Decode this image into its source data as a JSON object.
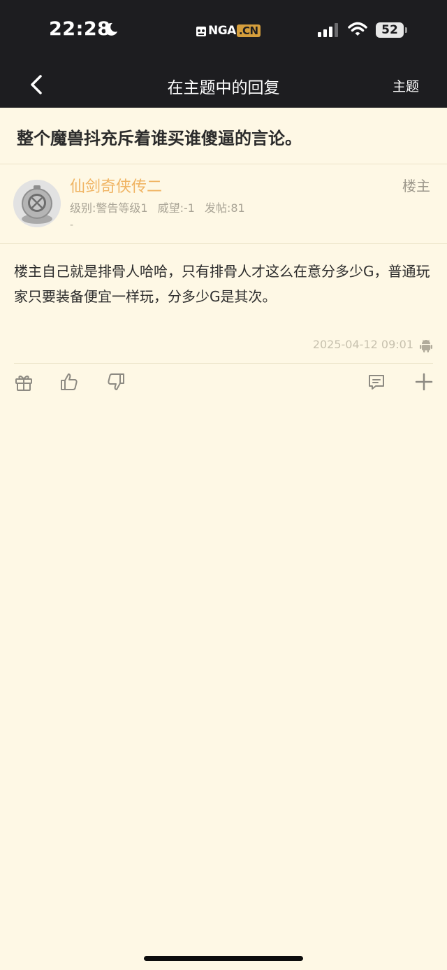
{
  "status_bar": {
    "time": "22:28",
    "moon_icon": "moon-icon",
    "logo_main": "NGA",
    "logo_suffix": ".CN",
    "battery": "52"
  },
  "nav": {
    "title": "在主题中的回复",
    "right_label": "主题"
  },
  "thread": {
    "title": "整个魔兽抖充斥着谁买谁傻逼的言论。"
  },
  "post": {
    "username": "仙剑奇侠传二",
    "level": "级别:警告等级1",
    "prestige": "威望:-1",
    "posts": "发帖:81",
    "signature": "-",
    "badge": "楼主",
    "content": "楼主自己就是排骨人哈哈，只有排骨人才这么在意分多少G，普通玩家只要装备便宜一样玩，分多少G是其次。",
    "timestamp": "2025-04-12 09:01",
    "device_icon": "android-icon"
  },
  "actions": [
    "gift-icon",
    "thumbs-up-icon",
    "thumbs-down-icon",
    "comment-icon",
    "plus-icon"
  ],
  "colors": {
    "background": "#fef8e5",
    "header": "#1d1d20",
    "username": "#f0b463",
    "logo_accent": "#d59e3c"
  }
}
